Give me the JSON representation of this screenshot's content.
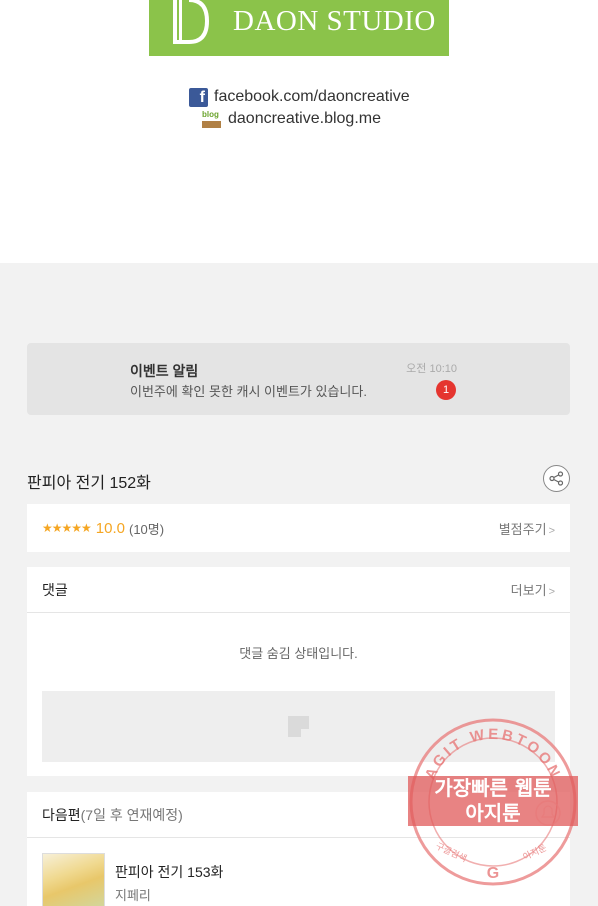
{
  "header": {
    "studio_name": "DAON STUDIO",
    "facebook": "facebook.com/daoncreative",
    "blog_label": "blog",
    "blog": "daoncreative.blog.me"
  },
  "notice": {
    "title": "이벤트 알림",
    "message": "이번주에 확인 못한 캐시 이벤트가 있습니다.",
    "time": "오전 10:10",
    "badge": "1"
  },
  "episode": {
    "title": "판피아 전기 152화",
    "stars": "★★★★★",
    "score": "10.0",
    "votes": "(10명)",
    "rate_label": "별점주기",
    "rate_chevron": ">"
  },
  "comments": {
    "label": "댓글",
    "more_label": "더보기",
    "more_chevron": ">",
    "hidden_message": "댓글 숨김 상태입니다."
  },
  "next": {
    "label": "다음편",
    "sub": "(7일 후 연재예정)",
    "item_title": "판피아 전기 153화",
    "item_author": "지페리"
  },
  "watermark": {
    "arc_text": "AGIT WEBTOON",
    "line1": "가장빠른 웹툰",
    "line2": "아지툰",
    "bottom_left": "구글검색",
    "bottom_right": "아지툰",
    "google": "G"
  },
  "colors": {
    "brand_green": "#8bc34a",
    "accent_orange": "#f5a623",
    "badge_red": "#e5352f",
    "stamp_red": "#e05a5a"
  }
}
